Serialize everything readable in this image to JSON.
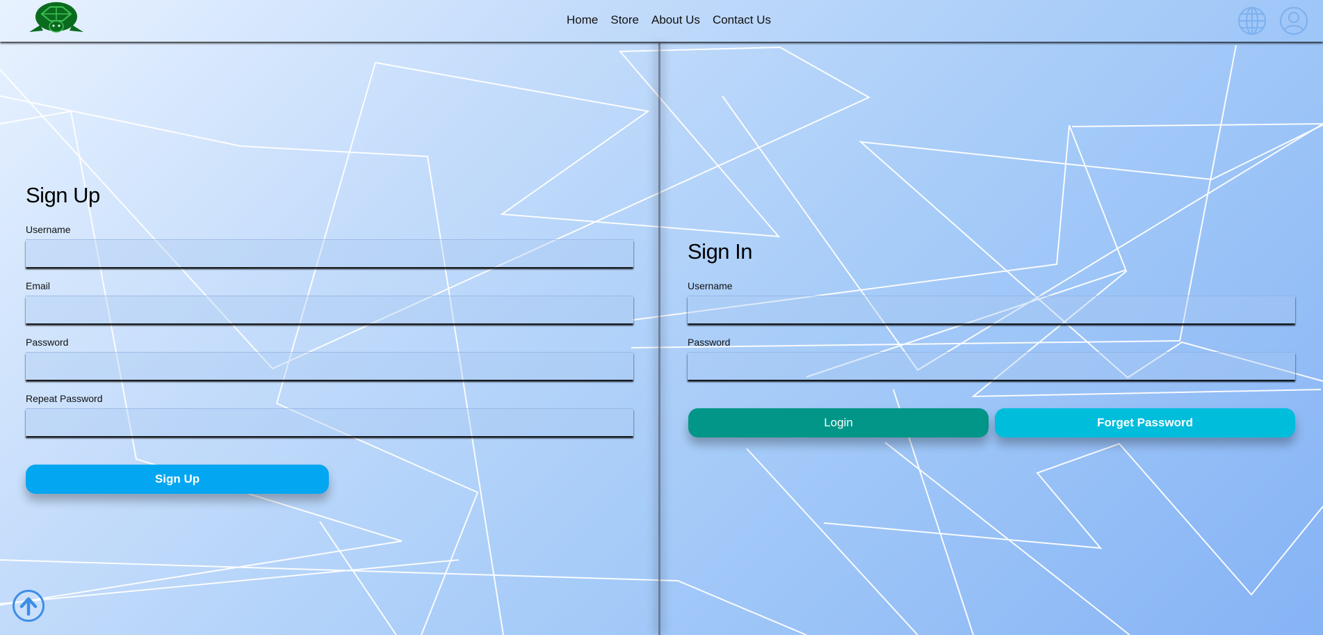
{
  "nav": {
    "logo_icon": "turtle-logo-icon",
    "links": [
      "Home",
      "Store",
      "About Us",
      "Contact Us"
    ],
    "globe_icon": "globe-icon",
    "profile_icon": "user-profile-icon"
  },
  "signup": {
    "title": "Sign Up",
    "username_label": "Username",
    "email_label": "Email",
    "password_label": "Password",
    "repeat_password_label": "Repeat Password",
    "button_label": "Sign Up"
  },
  "signin": {
    "title": "Sign In",
    "username_label": "Username",
    "password_label": "Password",
    "login_label": "Login",
    "forget_label": "Forget Password"
  },
  "scroll_top_icon": "arrow-up-circle-icon",
  "colors": {
    "signup_button": "#03a6f0",
    "login_button": "#019688",
    "forget_button": "#00bddc",
    "logo_green": "#0a6b1e",
    "icon_blue": "#7fb2ee"
  }
}
